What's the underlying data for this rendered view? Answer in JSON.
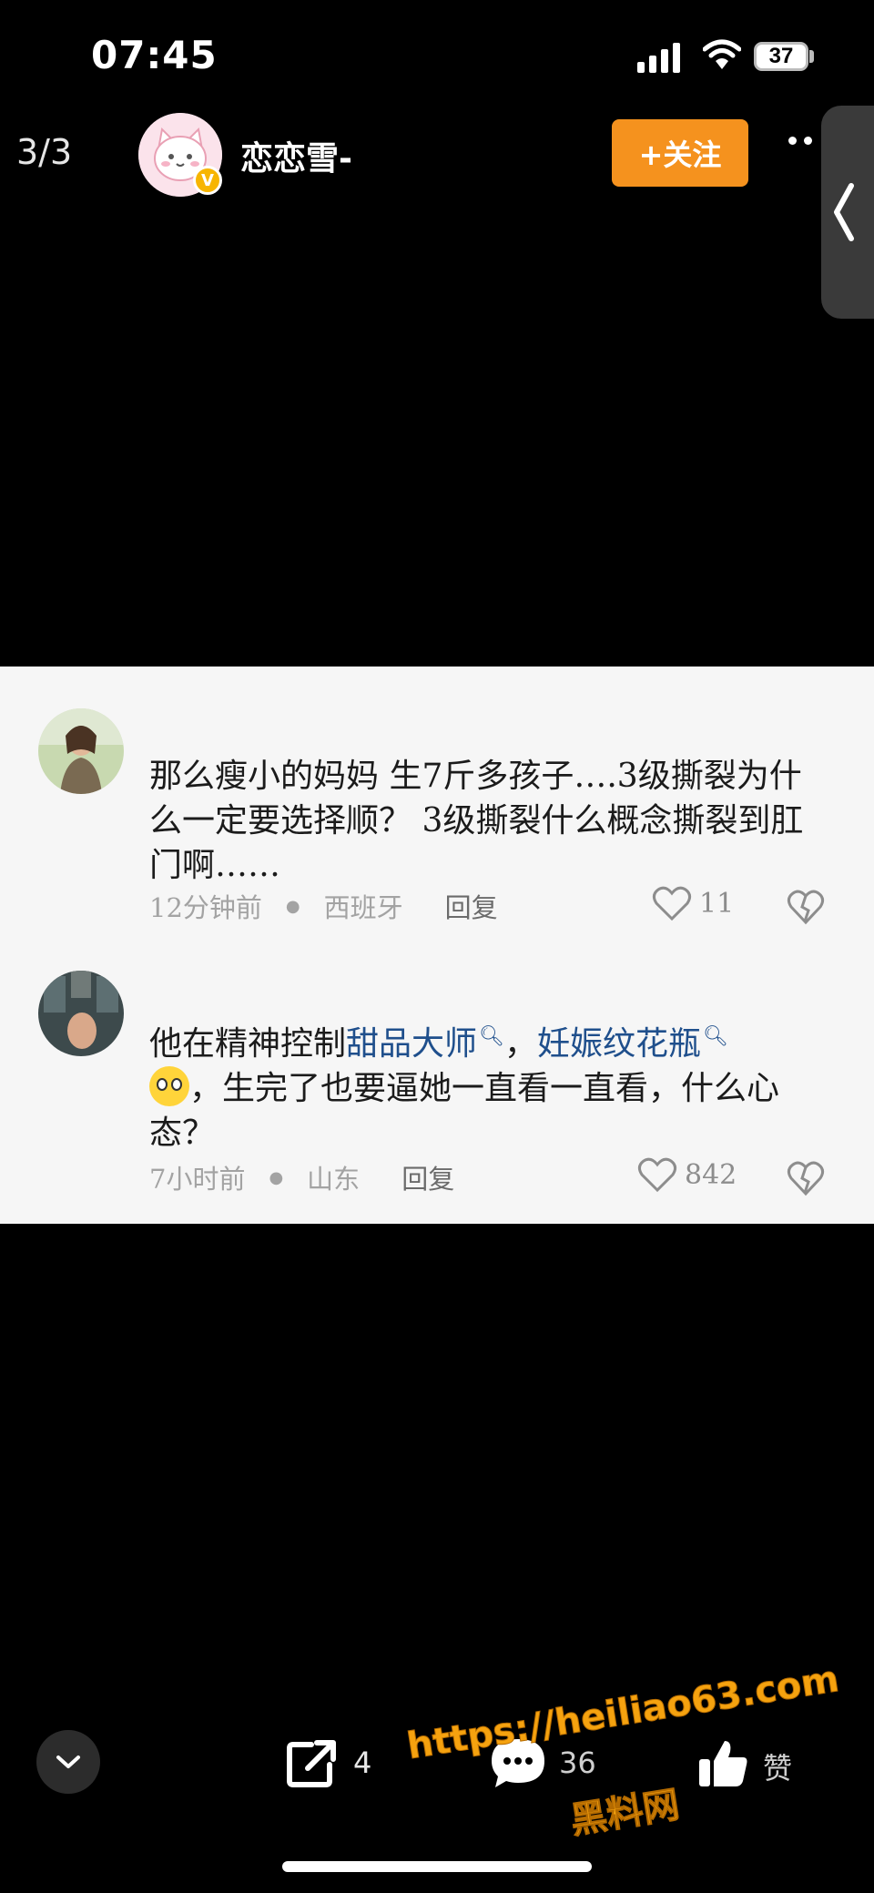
{
  "status_bar": {
    "time": "07:45",
    "battery": "37"
  },
  "header": {
    "page_counter": "3/3",
    "username": "恋恋雪-",
    "follow_label": "+关注"
  },
  "comments": [
    {
      "text": "那么瘦小的妈妈 生7斤多孩子….3级撕裂为什么一定要选择顺？ 3级撕裂什么概念撕裂到肛门啊……",
      "time": "12分钟前",
      "location": "西班牙",
      "reply_label": "回复",
      "likes": "11"
    },
    {
      "text_before": "他在精神控制",
      "keyword1": "甜品大师",
      "sep": "，",
      "keyword2": "妊娠纹花瓶",
      "text_after": "，生完了也要逼她一直看一直看，什么心态？",
      "time": "7小时前",
      "location": "山东",
      "reply_label": "回复",
      "likes": "842"
    }
  ],
  "bottom_bar": {
    "share_count": "4",
    "comment_count": "36",
    "like_label": "赞"
  },
  "watermark": {
    "url": "https://heiliao63.com",
    "name": "黑料网"
  },
  "colors": {
    "follow": "#f5921e",
    "keyword": "#1f4f8c",
    "watermark": "#f5a20f"
  }
}
